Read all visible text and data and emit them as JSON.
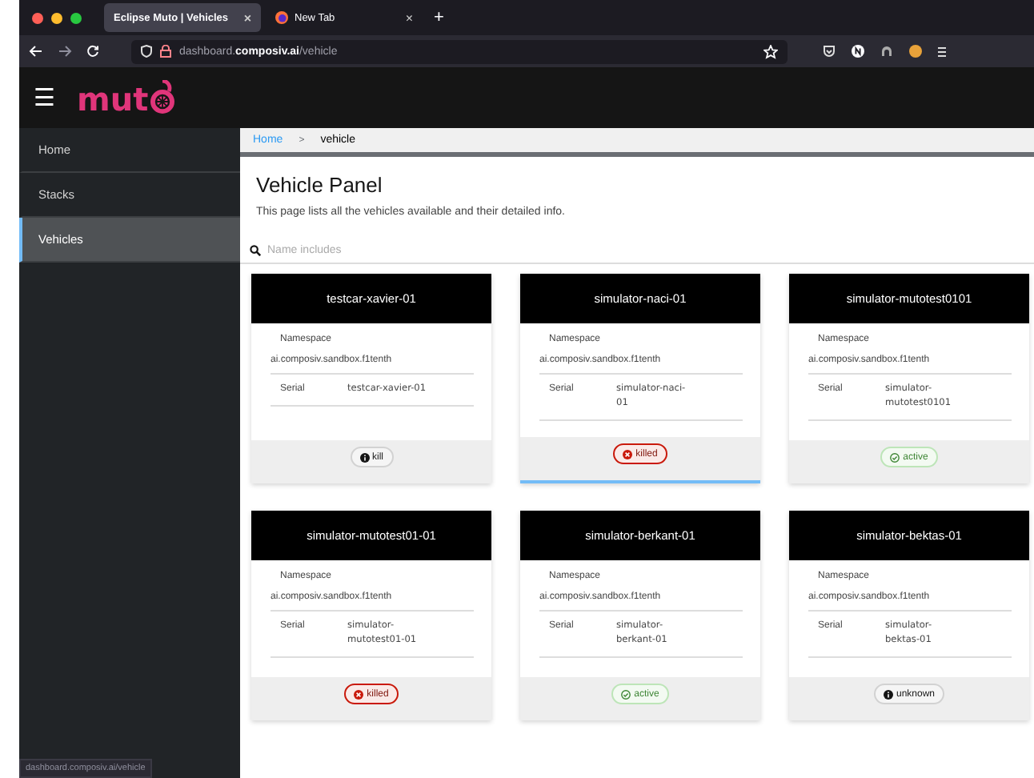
{
  "browser": {
    "tabs": [
      {
        "title": "Eclipse Muto | Vehicles",
        "selected": true,
        "close": "×"
      },
      {
        "title": "New Tab",
        "selected": false,
        "close": "×"
      }
    ],
    "new_tab": "+",
    "address": "dashboard.**composiv.ai**/vehicle"
  },
  "header": {
    "menu": "☰",
    "logo": "mut"
  },
  "sidebar": {
    "items": [
      {
        "label": "Home",
        "selected": false
      },
      {
        "label": "Stacks",
        "selected": false
      },
      {
        "label": "Vehicles",
        "selected": true
      }
    ]
  },
  "breadcrumb": {
    "home": "Home",
    "separator": ">",
    "current": "vehicle"
  },
  "page": {
    "title": "Vehicle Panel",
    "description": "This page lists all the vehicles available and their detailed info."
  },
  "search": {
    "placeholder": "Name includes"
  },
  "vehicles": [
    {
      "name": "testcar-xavier-01",
      "namespace_label": "Namespace",
      "namespace": "ai.composiv.sandbox.f1tenth",
      "serial_label": "Serial",
      "serial": "testcar-xavier-01",
      "status": {
        "label": "kill",
        "kind": "unknown"
      },
      "selected": false
    },
    {
      "name": "simulator-naci-01",
      "namespace_label": "Namespace",
      "namespace": "ai.composiv.sandbox.f1tenth",
      "serial_label": "Serial",
      "serial": "simulator-naci-01",
      "status": {
        "label": "killed",
        "kind": "killed"
      },
      "selected": true
    },
    {
      "name": "simulator-mutotest0101",
      "namespace_label": "Namespace",
      "namespace": "ai.composiv.sandbox.f1tenth",
      "serial_label": "Serial",
      "serial": "simulator-mutotest0101",
      "status": {
        "label": "active",
        "kind": "active"
      },
      "selected": false
    },
    {
      "name": "simulator-mutotest01-01",
      "namespace_label": "Namespace",
      "namespace": "ai.composiv.sandbox.f1tenth",
      "serial_label": "Serial",
      "serial": "simulator-mutotest01-01",
      "status": {
        "label": "killed",
        "kind": "killed"
      },
      "selected": false
    },
    {
      "name": "simulator-berkant-01",
      "namespace_label": "Namespace",
      "namespace": "ai.composiv.sandbox.f1tenth",
      "serial_label": "Serial",
      "serial": "simulator-berkant-01",
      "status": {
        "label": "active",
        "kind": "active"
      },
      "selected": false
    },
    {
      "name": "simulator-bektas-01",
      "namespace_label": "Namespace",
      "namespace": "ai.composiv.sandbox.f1tenth",
      "serial_label": "Serial",
      "serial": "simulator-bektas-01",
      "status": {
        "label": "unknown",
        "kind": "unknown"
      },
      "selected": false
    }
  ],
  "status_bar": "dashboard.composiv.ai/vehicle"
}
